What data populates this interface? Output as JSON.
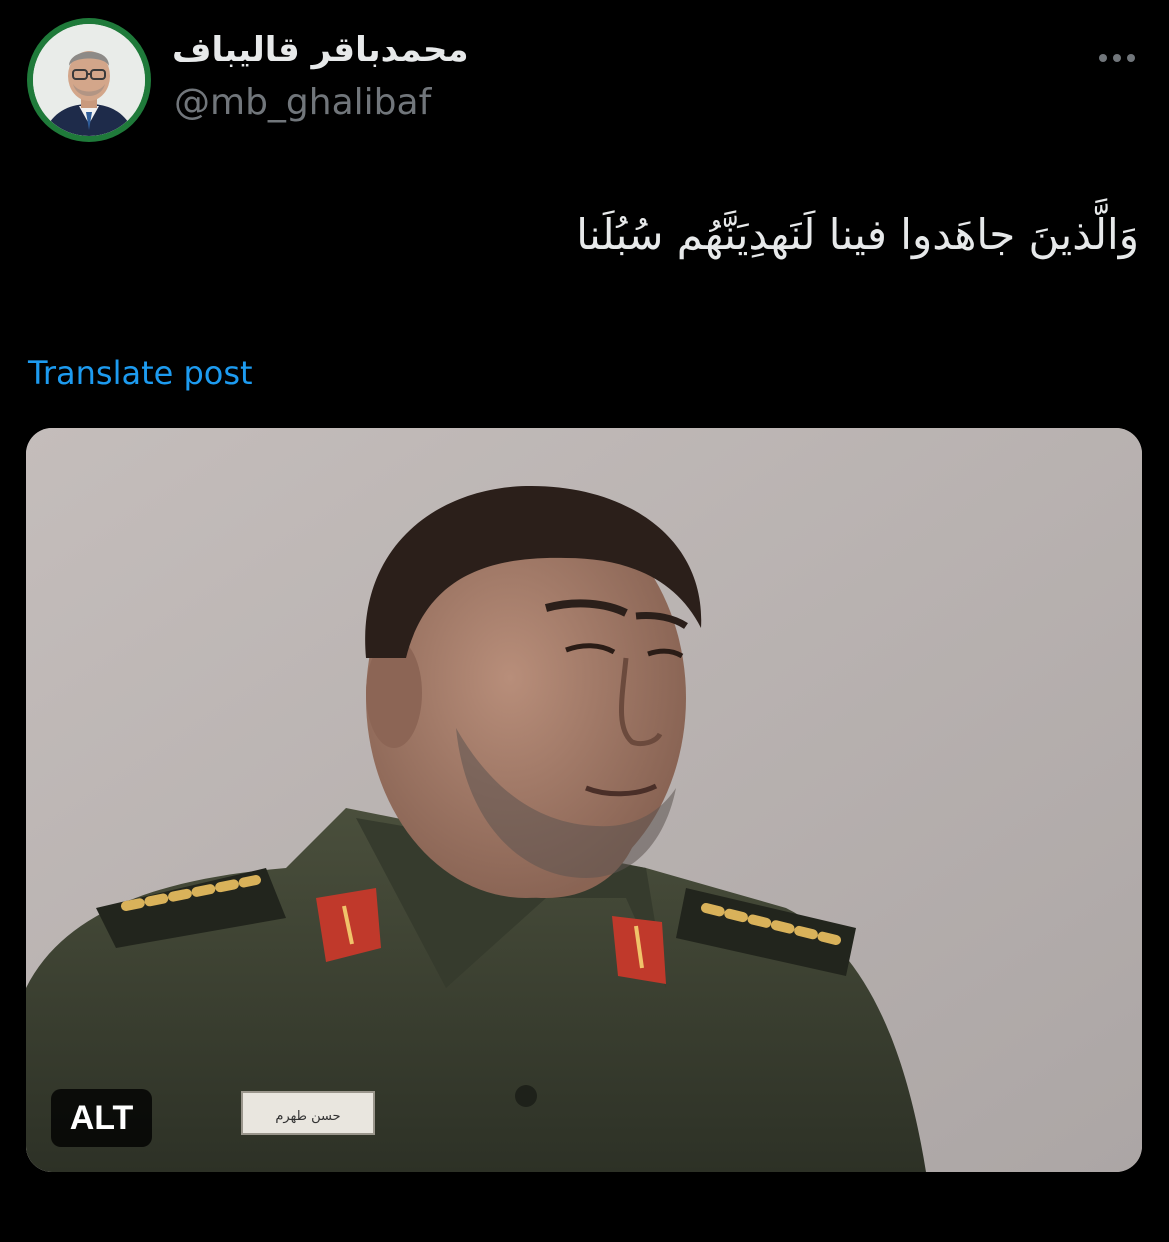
{
  "post": {
    "author": {
      "display_name": "محمدباقر قالیباف",
      "handle": "@mb_ghalibaf"
    },
    "more_icon": "more-horizontal-icon",
    "text": "وَالَّذينَ جاهَدوا فينا لَنَهدِيَنَّهُم سُبُلَنا",
    "translate_label": "Translate post",
    "media": {
      "alt_label": "ALT",
      "nameplate_text": "حسن طهرم"
    }
  },
  "colors": {
    "background": "#000000",
    "primary_text": "#e7e9ea",
    "secondary_text": "#71767b",
    "link": "#1d9bf0",
    "avatar_ring": "#1f7a3a"
  }
}
